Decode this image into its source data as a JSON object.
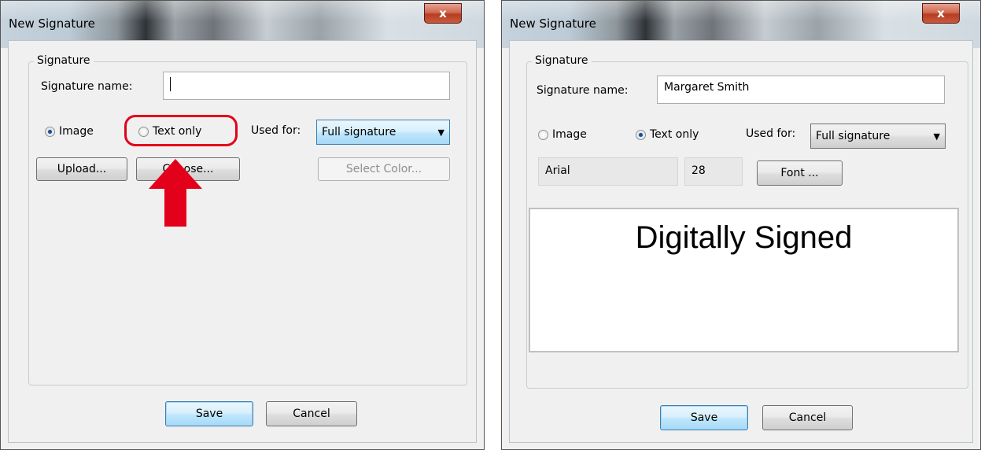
{
  "left_dialog": {
    "title": "New Signature",
    "close_label": "x",
    "group_label": "Signature",
    "name_label": "Signature name:",
    "name_value": "",
    "radio_image": "Image",
    "radio_text_only": "Text only",
    "selected": "Image",
    "used_for_label": "Used for:",
    "used_for_value": "Full signature",
    "upload_button": "Upload...",
    "choose_button": "Choose...",
    "select_color_button": "Select Color...",
    "save_button": "Save",
    "cancel_button": "Cancel",
    "annotation_color": "#e3001b"
  },
  "right_dialog": {
    "title": "New Signature",
    "close_label": "x",
    "group_label": "Signature",
    "name_label": "Signature name:",
    "name_value": "Margaret Smith",
    "radio_image": "Image",
    "radio_text_only": "Text only",
    "selected": "Text only",
    "used_for_label": "Used for:",
    "used_for_value": "Full signature",
    "font_name": "Arial",
    "font_size": "28",
    "font_button": "Font ...",
    "preview_text": "Digitally Signed",
    "save_button": "Save",
    "cancel_button": "Cancel"
  }
}
